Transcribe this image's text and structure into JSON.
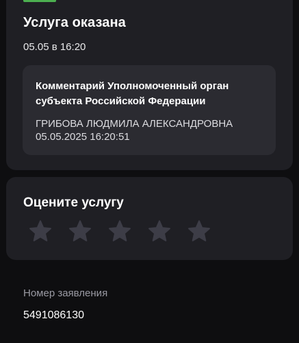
{
  "status": {
    "title": "Услуга оказана",
    "time": "05.05 в 16:20",
    "accent_color": "#4caf50"
  },
  "comment": {
    "title": "Комментарий Уполномоченный орган субъекта Российской Федерации",
    "author": "ГРИБОВА ЛЮДМИЛА АЛЕКСАНДРОВНА",
    "date": "05.05.2025 16:20:51"
  },
  "rating": {
    "title": "Оцените услугу",
    "max_stars": 5,
    "selected": 0,
    "star_color": "#3d3d47"
  },
  "application": {
    "label": "Номер заявления",
    "value": "5491086130"
  }
}
